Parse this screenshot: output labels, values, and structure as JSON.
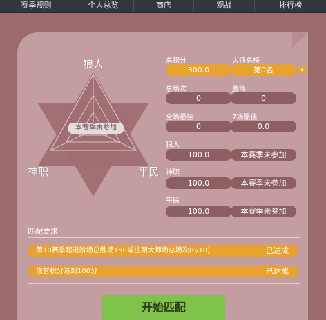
{
  "nav": [
    {
      "label": "赛季规则"
    },
    {
      "label": "个人总览"
    },
    {
      "label": "商店"
    },
    {
      "label": "观战"
    },
    {
      "label": "排行榜"
    }
  ],
  "radar": {
    "roles": {
      "top": "狼人",
      "left": "神职",
      "right": "平民"
    },
    "center_text": "本赛季未参加"
  },
  "stats": {
    "total_score_label": "总积分",
    "total_score": "300.0",
    "master_rank_label": "大师总榜",
    "master_rank": "第0名",
    "total_games_label": "总场次",
    "total_games": "0",
    "wins_label": "胜场",
    "wins": "0",
    "best_all_label": "全场最佳",
    "best_all": "0",
    "best_7_label": "7场最佳",
    "best_7": "0.0",
    "werewolf_label": "狼人",
    "werewolf_score": "100.0",
    "werewolf_status": "本赛季未参加",
    "god_label": "神职",
    "god_score": "100.0",
    "god_status": "本赛季未参加",
    "villager_label": "平民",
    "villager_score": "100.0",
    "villager_status": "本赛季未参加"
  },
  "requirements": {
    "title": "匹配要求",
    "items": [
      {
        "text": "第10赛季起进阶场总胜场150或往期大师场总场次(0/10)",
        "status": "已达成"
      },
      {
        "text": "信誉积分达到100分",
        "status": "已达成"
      }
    ]
  },
  "start_button": "开始匹配",
  "colors": {
    "background": "#9a6a6d",
    "panel": "#c49da1",
    "gold": "#e8a22f",
    "dark_box": "#8d5f63",
    "start_button": "#7fc34a"
  }
}
